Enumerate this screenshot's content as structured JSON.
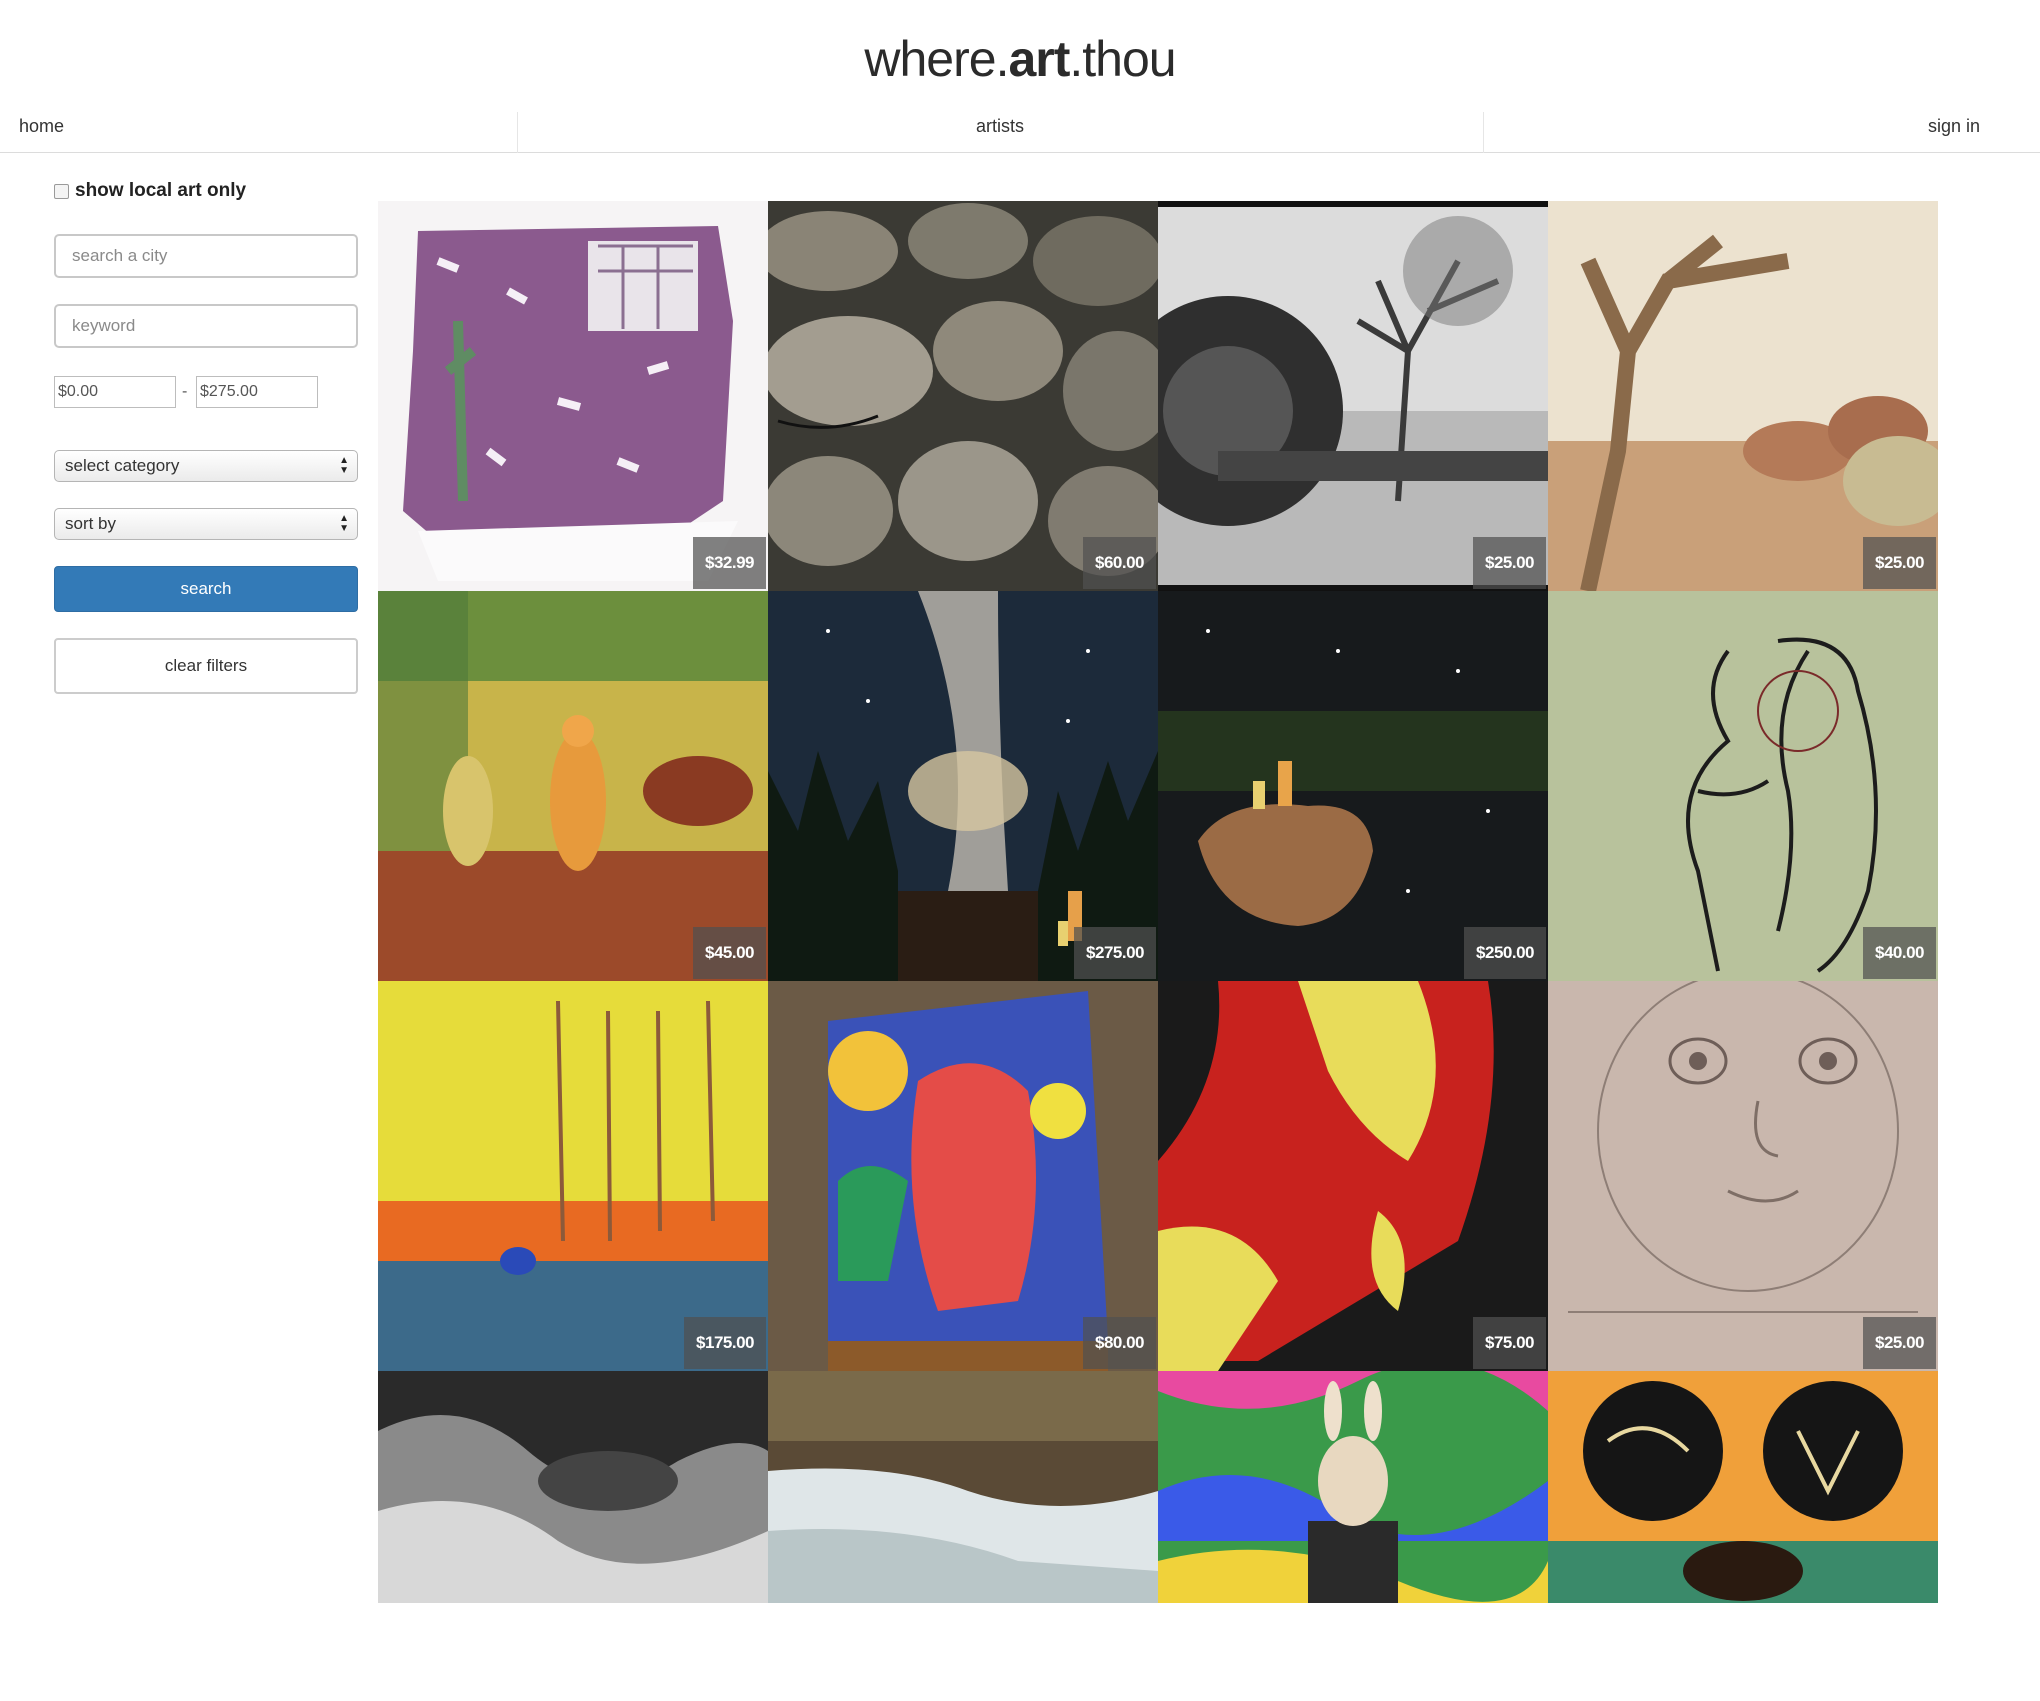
{
  "header": {
    "logo_prefix": "where.",
    "logo_bold": "art",
    "logo_suffix": ".thou"
  },
  "nav": {
    "home": "home",
    "artists": "artists",
    "sign_in": "sign in"
  },
  "filters": {
    "local_only_label": "show local art only",
    "local_only_checked": false,
    "city_placeholder": "search a city",
    "keyword_placeholder": "keyword",
    "min_price": "$0.00",
    "range_separator": "-",
    "max_price": "$275.00",
    "category_select": "select category",
    "sort_select": "sort by",
    "search_button": "search",
    "clear_button": "clear filters"
  },
  "artworks": [
    {
      "price": "$32.99",
      "subject": "purple brick wall painting with cactus and window"
    },
    {
      "price": "$60.00",
      "subject": "stacked stone wall photo"
    },
    {
      "price": "$25.00",
      "subject": "black and white train wheel with tree"
    },
    {
      "price": "$25.00",
      "subject": "dead tree in desert"
    },
    {
      "price": "$45.00",
      "subject": "colorful deer collage"
    },
    {
      "price": "$275.00",
      "subject": "milky way over forest painting"
    },
    {
      "price": "$250.00",
      "subject": "cartoon characters on rock under stars"
    },
    {
      "price": "$40.00",
      "subject": "line drawing of faces on green paper"
    },
    {
      "price": "$175.00",
      "subject": "yellow sunset painting with bird and trees"
    },
    {
      "price": "$80.00",
      "subject": "abstract colorful faces painting on easel"
    },
    {
      "price": "$75.00",
      "subject": "red yellow black portrait painting"
    },
    {
      "price": "$25.00",
      "subject": "pencil sketch of baby face"
    },
    {
      "price": "",
      "subject": "black and white rock formation"
    },
    {
      "price": "",
      "subject": "waterfall long exposure"
    },
    {
      "price": "",
      "subject": "psychedelic bunny mask portrait"
    },
    {
      "price": "",
      "subject": "mouse ears painting with crab"
    }
  ]
}
